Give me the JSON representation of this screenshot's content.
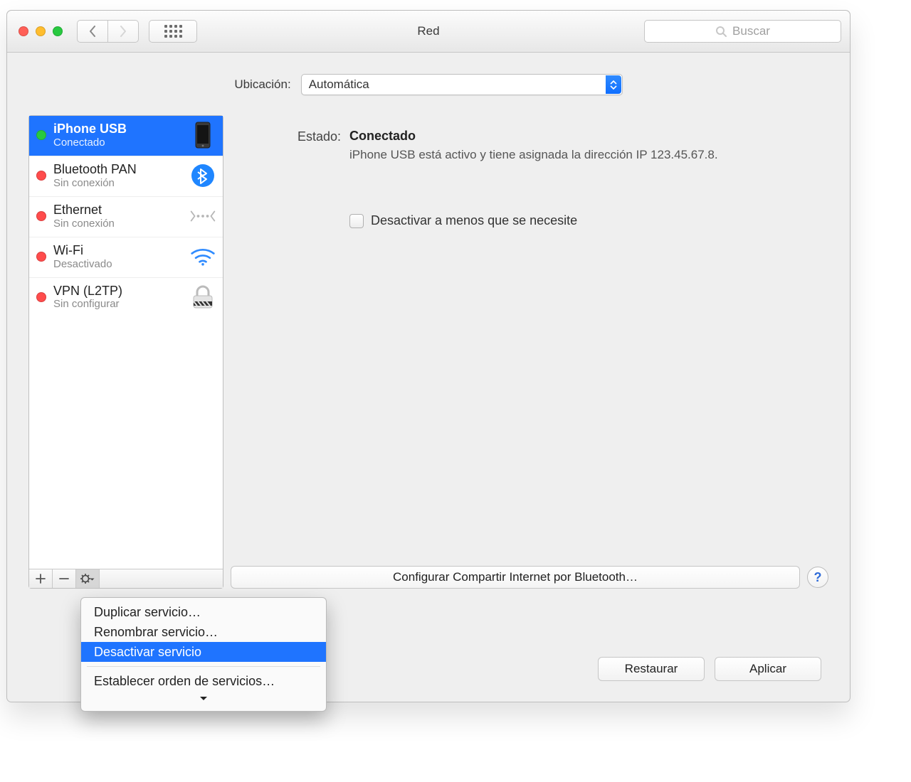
{
  "window": {
    "title": "Red",
    "search_placeholder": "Buscar"
  },
  "location": {
    "label": "Ubicación:",
    "value": "Automática"
  },
  "services": [
    {
      "name": "iPhone USB",
      "status": "Conectado",
      "dot": "green",
      "icon": "iphone",
      "selected": true
    },
    {
      "name": "Bluetooth PAN",
      "status": "Sin conexión",
      "dot": "red",
      "icon": "bluetooth",
      "selected": false
    },
    {
      "name": "Ethernet",
      "status": "Sin conexión",
      "dot": "red",
      "icon": "ethernet",
      "selected": false
    },
    {
      "name": "Wi-Fi",
      "status": "Desactivado",
      "dot": "red",
      "icon": "wifi",
      "selected": false
    },
    {
      "name": "VPN (L2TP)",
      "status": "Sin configurar",
      "dot": "red",
      "icon": "vpn",
      "selected": false
    }
  ],
  "detail": {
    "status_label": "Estado:",
    "status_value": "Conectado",
    "status_description": "iPhone USB  está activo y tiene asignada la dirección IP 123.45.67.8.",
    "checkbox_label": "Desactivar a menos que se necesite",
    "configure_button": "Configurar Compartir Internet por Bluetooth…"
  },
  "buttons": {
    "restore": "Restaurar",
    "apply": "Aplicar"
  },
  "menu": {
    "items": [
      {
        "label": "Duplicar servicio…",
        "sel": false
      },
      {
        "label": "Renombrar servicio…",
        "sel": false
      },
      {
        "label": "Desactivar servicio",
        "sel": true
      }
    ],
    "more": "Establecer orden de servicios…"
  }
}
